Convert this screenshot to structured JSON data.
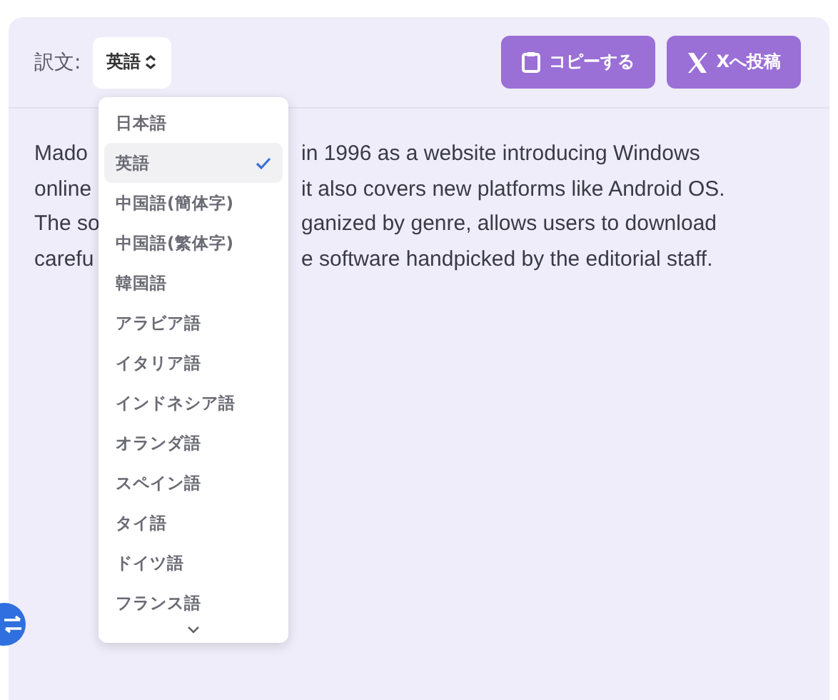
{
  "label": "訳文:",
  "select": {
    "value": "英語",
    "expanded": true
  },
  "buttons": [
    {
      "kind": "copy",
      "label": "コピーする"
    },
    {
      "kind": "x",
      "label": "Xへ投稿"
    }
  ],
  "paragraph_lines": [
    {
      "left": "Mado",
      "right": "in 1996 as a website introducing Windows"
    },
    {
      "left": "online",
      "right": "it also covers new platforms like Android OS."
    },
    {
      "left": "The so",
      "right": "ganized by genre, allows users to download"
    },
    {
      "left": "carefu",
      "right": "e software handpicked by the editorial staff."
    }
  ],
  "options": [
    {
      "label": "日本語",
      "selected": false
    },
    {
      "label": "英語",
      "selected": true
    },
    {
      "label": "中国語(簡体字)",
      "selected": false
    },
    {
      "label": "中国語(繁体字)",
      "selected": false
    },
    {
      "label": "韓国語",
      "selected": false
    },
    {
      "label": "アラビア語",
      "selected": false
    },
    {
      "label": "イタリア語",
      "selected": false
    },
    {
      "label": "インドネシア語",
      "selected": false
    },
    {
      "label": "オランダ語",
      "selected": false
    },
    {
      "label": "スペイン語",
      "selected": false
    },
    {
      "label": "タイ語",
      "selected": false
    },
    {
      "label": "ドイツ語",
      "selected": false
    },
    {
      "label": "フランス語",
      "selected": false
    }
  ]
}
